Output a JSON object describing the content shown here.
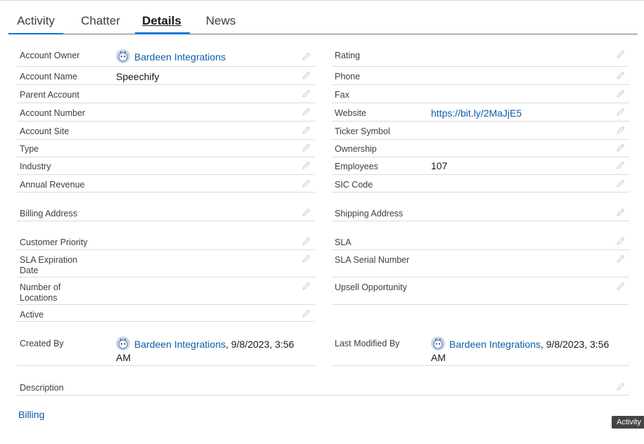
{
  "tabs": [
    {
      "label": "Activity"
    },
    {
      "label": "Chatter"
    },
    {
      "label": "Details"
    },
    {
      "label": "News"
    }
  ],
  "left": {
    "account_owner": {
      "label": "Account Owner",
      "value": "Bardeen Integrations"
    },
    "account_name": {
      "label": "Account Name",
      "value": "Speechify"
    },
    "parent_account": {
      "label": "Parent Account",
      "value": ""
    },
    "account_number": {
      "label": "Account Number",
      "value": ""
    },
    "account_site": {
      "label": "Account Site",
      "value": ""
    },
    "type": {
      "label": "Type",
      "value": ""
    },
    "industry": {
      "label": "Industry",
      "value": ""
    },
    "annual_revenue": {
      "label": "Annual Revenue",
      "value": ""
    },
    "billing_address": {
      "label": "Billing Address",
      "value": ""
    },
    "customer_priority": {
      "label": "Customer Priority",
      "value": ""
    },
    "sla_expiration_date": {
      "label_line1": "SLA Expiration",
      "label_line2": "Date",
      "value": ""
    },
    "number_of_locations": {
      "label_line1": "Number of",
      "label_line2": "Locations",
      "value": ""
    },
    "active": {
      "label": "Active",
      "value": ""
    },
    "created_by": {
      "label": "Created By",
      "user": "Bardeen Integrations",
      "date_line1": ", 9/8/2023, 3:56",
      "date_line2": "AM"
    },
    "description": {
      "label": "Description",
      "value": ""
    }
  },
  "right": {
    "rating": {
      "label": "Rating",
      "value": ""
    },
    "phone": {
      "label": "Phone",
      "value": ""
    },
    "fax": {
      "label": "Fax",
      "value": ""
    },
    "website": {
      "label": "Website",
      "value": "https://bit.ly/2MaJjE5"
    },
    "ticker_symbol": {
      "label": "Ticker Symbol",
      "value": ""
    },
    "ownership": {
      "label": "Ownership",
      "value": ""
    },
    "employees": {
      "label": "Employees",
      "value": "107"
    },
    "sic_code": {
      "label": "SIC Code",
      "value": ""
    },
    "shipping_address": {
      "label": "Shipping Address",
      "value": ""
    },
    "sla": {
      "label": "SLA",
      "value": ""
    },
    "sla_serial_number": {
      "label": "SLA Serial Number",
      "value": ""
    },
    "upsell_opportunity": {
      "label": "Upsell Opportunity",
      "value": ""
    },
    "last_modified_by": {
      "label": "Last Modified By",
      "user": "Bardeen Integrations",
      "date_line1": ", 9/8/2023, 3:56",
      "date_line2": "AM"
    }
  },
  "section_link": "Billing",
  "tooltip": "Activity",
  "colors": {
    "link": "#0b5cab",
    "accent": "#0176d3"
  },
  "icons": {
    "edit": "pencil-icon",
    "avatar": "bot-avatar-icon"
  }
}
